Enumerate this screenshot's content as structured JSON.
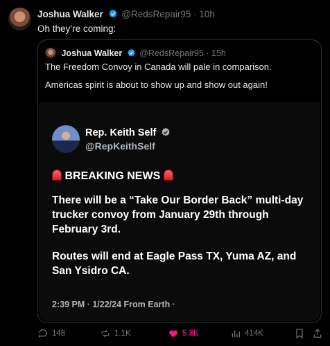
{
  "post": {
    "author_name": "Joshua Walker",
    "handle": "@RedsRepair95",
    "separator": "·",
    "time": "10h",
    "text": "Oh they’re coming:"
  },
  "quote": {
    "author_name": "Joshua Walker",
    "handle": "@RedsRepair95",
    "separator": "·",
    "time": "15h",
    "line1": "The Freedom Convoy in Canada will pale in comparison.",
    "line2": "Americas spirit is about to show up and show out again!"
  },
  "media": {
    "name": "Rep. Keith Self",
    "handle": "@RepKeithSelf",
    "breaking": "BREAKING NEWS",
    "para1": "There will be a “Take Our Border Back” multi-day trucker convoy from January 29th through February 3rd.",
    "para2": "Routes will end at Eagle Pass TX, Yuma AZ, and San Ysidro CA.",
    "timestamp": "2:39 PM · 1/22/24 From Earth ·"
  },
  "actions": {
    "replies": "148",
    "reposts": "1.1K",
    "likes": "5.8K",
    "views": "414K"
  },
  "colors": {
    "verified": "#1d9bf0",
    "like": "#f91880",
    "muted": "#71767b"
  }
}
